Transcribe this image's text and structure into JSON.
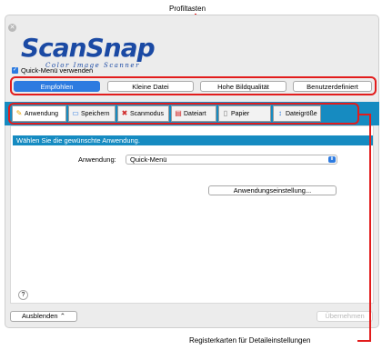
{
  "callouts": {
    "profile_keys": "Profiltasten",
    "detail_tabs": "Registerkarten für Detaileinstellungen"
  },
  "logo": {
    "main": "ScanSnap",
    "sub": "Color Image Scanner"
  },
  "quick_menu": {
    "label": "Quick-Menü verwenden",
    "checked": true
  },
  "profiles": [
    {
      "label": "Empfohlen",
      "active": true
    },
    {
      "label": "Kleine Datei",
      "active": false
    },
    {
      "label": "Hohe Bildqualität",
      "active": false
    },
    {
      "label": "Benutzerdefiniert",
      "active": false
    }
  ],
  "tabs": [
    {
      "label": "Anwendung",
      "icon": "application-icon",
      "active": true
    },
    {
      "label": "Speichern",
      "icon": "folder-icon",
      "active": false
    },
    {
      "label": "Scanmodus",
      "icon": "scan-mode-icon",
      "active": false
    },
    {
      "label": "Dateiart",
      "icon": "pdf-icon",
      "active": false
    },
    {
      "label": "Papier",
      "icon": "paper-icon",
      "active": false
    },
    {
      "label": "Dateigröße",
      "icon": "file-size-icon",
      "active": false
    }
  ],
  "panel": {
    "header": "Wählen Sie die gewünschte Anwendung.",
    "app_label": "Anwendung:",
    "app_value": "Quick-Menü",
    "settings_button": "Anwendungseinstellung..."
  },
  "footer": {
    "help": "?",
    "hide_button": "Ausblenden",
    "apply_button": "Übernehmen"
  },
  "colors": {
    "accent_blue": "#168bc1",
    "button_blue": "#2d7be0",
    "callout_red": "#e21c1c",
    "logo_blue": "#1b4aa4"
  }
}
